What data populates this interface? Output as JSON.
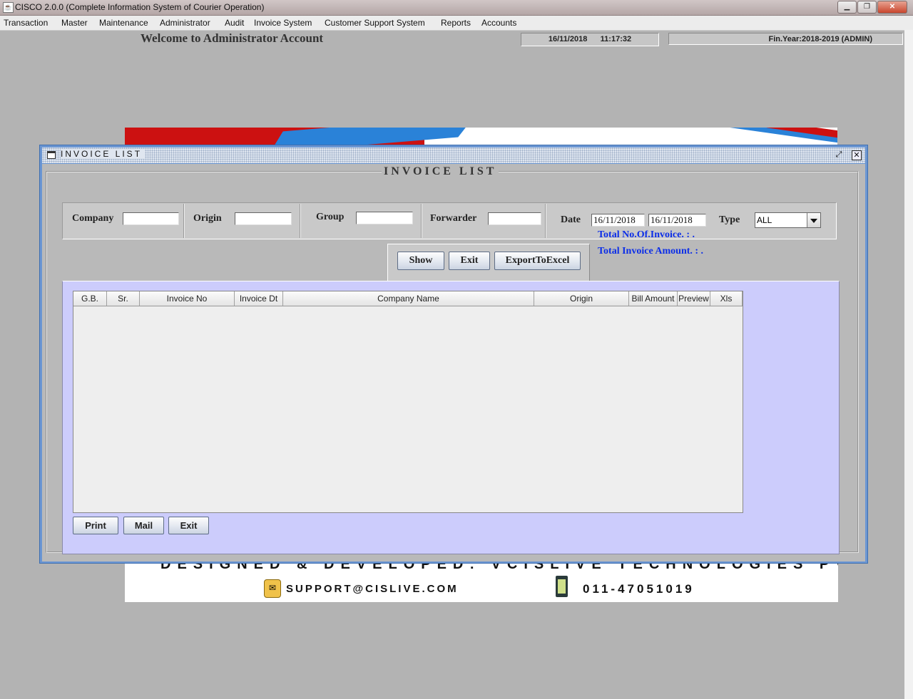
{
  "window": {
    "title": "CISCO 2.0.0 (Complete Information System of Courier Operation)",
    "minimize_glyph": "▁",
    "restore_glyph": "❐",
    "close_glyph": "✕"
  },
  "menu": [
    "Transaction",
    "Master",
    "Maintenance",
    "Administrator",
    "Audit",
    "Invoice System",
    "Customer Support System",
    "Reports",
    "Accounts"
  ],
  "header": {
    "welcome": "Welcome to Administrator Account",
    "datetime": "16/11/2018      11:17:32",
    "finyear": "Fin.Year:2018-2019  (ADMIN)"
  },
  "banner": {
    "designed": "DESIGNED & DEVELOPED:  VCISLIVE TECHNOLOGIES PVT LTD",
    "support": "SUPPORT@CISLIVE.COM",
    "phone": "011-47051019"
  },
  "invoice_window": {
    "frame_title": "INVOICE LIST",
    "group_title": "INVOICE LIST",
    "restore_glyph": "⤢",
    "close_glyph": "✕"
  },
  "filters": {
    "company_label": "Company",
    "company_value": "",
    "origin_label": "Origin",
    "origin_value": "",
    "group_label": "Group",
    "group_value": "",
    "forwarder_label": "Forwarder",
    "forwarder_value": "",
    "date_label": "Date",
    "date_from": "16/11/2018",
    "date_to": "16/11/2018",
    "type_label": "Type",
    "type_value": "ALL"
  },
  "actions": {
    "show": "Show",
    "exit": "Exit",
    "export": "ExportToExcel"
  },
  "totals": {
    "count_label": "Total No.Of.Invoice.    :    .",
    "amount_label": "Total Invoice Amount. :   ."
  },
  "table": {
    "columns": [
      "G.B.",
      "Sr.",
      "Invoice No",
      "Invoice Dt",
      "Company Name",
      "Origin",
      "Bill Amount",
      "Preview",
      "Xls"
    ],
    "rows": []
  },
  "bottom_buttons": {
    "print": "Print",
    "mail": "Mail",
    "exit": "Exit"
  },
  "colors": {
    "desktop": "#b3b3b3",
    "frame_border": "#6b96d2",
    "panel": "#ccccfc",
    "totals_text": "#0c2ee8"
  }
}
